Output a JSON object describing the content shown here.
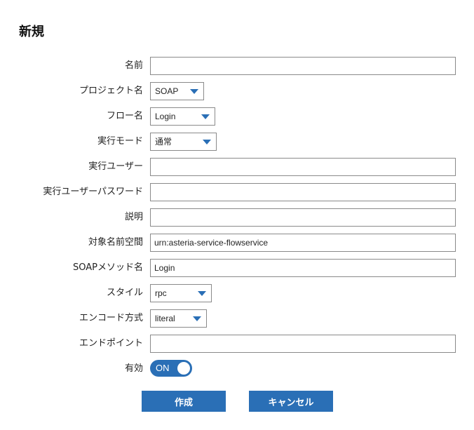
{
  "page": {
    "title": "新規"
  },
  "form": {
    "name": {
      "label": "名前",
      "value": ""
    },
    "project": {
      "label": "プロジェクト名",
      "value": "SOAP"
    },
    "flow": {
      "label": "フロー名",
      "value": "Login"
    },
    "exec_mode": {
      "label": "実行モード",
      "value": "通常"
    },
    "exec_user": {
      "label": "実行ユーザー",
      "value": ""
    },
    "exec_password": {
      "label": "実行ユーザーパスワード",
      "value": ""
    },
    "description": {
      "label": "説明",
      "value": ""
    },
    "target_namespace": {
      "label": "対象名前空間",
      "value": "urn:asteria-service-flowservice"
    },
    "soap_method": {
      "label": "SOAPメソッド名",
      "value": "Login"
    },
    "style": {
      "label": "スタイル",
      "value": "rpc"
    },
    "encoding": {
      "label": "エンコード方式",
      "value": "literal"
    },
    "endpoint": {
      "label": "エンドポイント",
      "value": ""
    },
    "enabled": {
      "label": "有効",
      "state": "ON"
    }
  },
  "actions": {
    "create_label": "作成",
    "cancel_label": "キャンセル"
  },
  "icons": {
    "dropdown": "chevron-down-icon"
  },
  "colors": {
    "accent": "#2a6fb6",
    "input_border": "#8a8a8a",
    "text": "#222222"
  }
}
